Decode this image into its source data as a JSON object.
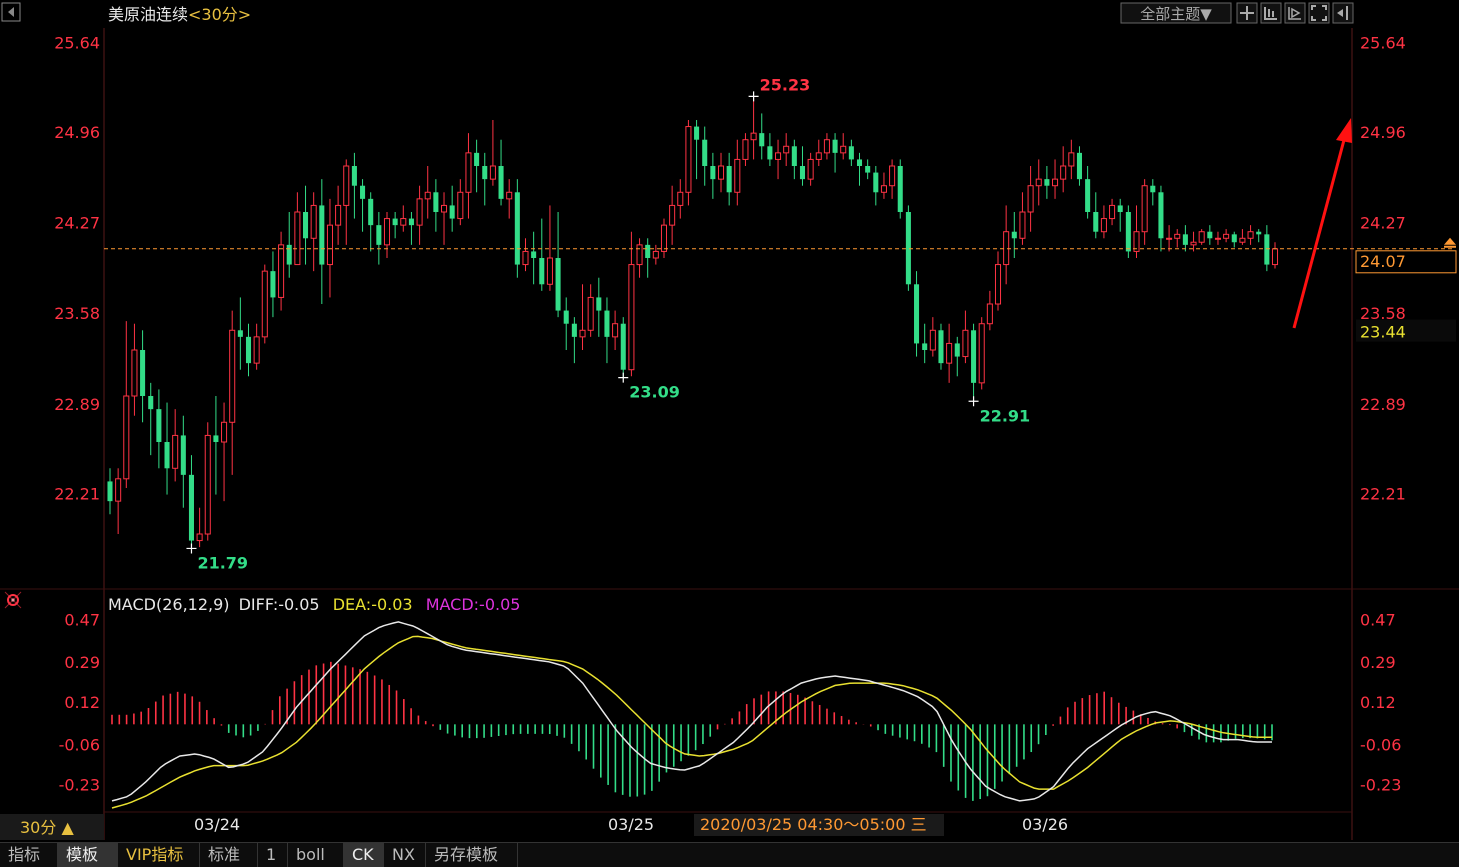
{
  "chart_data": [
    {
      "type": "candlestick",
      "title": "美原油连续",
      "period_label": "<30分>",
      "ylim": [
        21.55,
        25.75
      ],
      "y_ticks": [
        "25.64",
        "24.96",
        "24.27",
        "23.58",
        "22.89",
        "22.21"
      ],
      "last_price": "24.07",
      "side_label": "23.44",
      "annotations": {
        "high": "25.23",
        "low_1": "21.79",
        "low_2": "23.09",
        "low_3": "22.91"
      },
      "candles": [
        [
          22.3,
          22.15,
          22.4,
          22.05
        ],
        [
          22.15,
          22.32,
          22.4,
          21.9
        ],
        [
          22.32,
          22.95,
          23.52,
          22.25
        ],
        [
          22.95,
          23.3,
          23.5,
          22.8
        ],
        [
          23.3,
          22.95,
          23.45,
          22.75
        ],
        [
          22.95,
          22.85,
          23.05,
          22.5
        ],
        [
          22.85,
          22.6,
          23.0,
          22.4
        ],
        [
          22.6,
          22.4,
          22.9,
          22.2
        ],
        [
          22.4,
          22.65,
          22.85,
          22.3
        ],
        [
          22.65,
          22.35,
          22.8,
          22.1
        ],
        [
          22.35,
          21.85,
          22.5,
          21.79
        ],
        [
          21.85,
          21.9,
          22.1,
          21.8
        ],
        [
          21.9,
          22.65,
          22.75,
          21.85
        ],
        [
          22.65,
          22.6,
          22.95,
          22.2
        ],
        [
          22.6,
          22.75,
          22.9,
          22.15
        ],
        [
          22.75,
          23.45,
          23.6,
          22.35
        ],
        [
          23.45,
          23.4,
          23.7,
          23.15
        ],
        [
          23.4,
          23.2,
          23.5,
          23.1
        ],
        [
          23.2,
          23.4,
          23.5,
          23.15
        ],
        [
          23.4,
          23.9,
          23.95,
          23.35
        ],
        [
          23.9,
          23.7,
          24.05,
          23.55
        ],
        [
          23.7,
          24.1,
          24.2,
          23.6
        ],
        [
          24.1,
          23.95,
          24.35,
          23.85
        ],
        [
          23.95,
          24.35,
          24.5,
          24.0
        ],
        [
          24.35,
          24.15,
          24.55,
          23.95
        ],
        [
          24.15,
          24.4,
          24.5,
          23.9
        ],
        [
          24.4,
          23.95,
          24.6,
          23.65
        ],
        [
          23.95,
          24.25,
          24.45,
          23.7
        ],
        [
          24.25,
          24.4,
          24.55,
          24.1
        ],
        [
          24.4,
          24.7,
          24.75,
          24.1
        ],
        [
          24.7,
          24.55,
          24.8,
          24.3
        ],
        [
          24.55,
          24.45,
          24.6,
          24.2
        ],
        [
          24.45,
          24.25,
          24.5,
          24.05
        ],
        [
          24.25,
          24.1,
          24.35,
          23.95
        ],
        [
          24.1,
          24.3,
          24.35,
          24.0
        ],
        [
          24.3,
          24.25,
          24.35,
          24.15
        ],
        [
          24.25,
          24.3,
          24.4,
          24.2
        ],
        [
          24.3,
          24.25,
          24.35,
          24.1
        ],
        [
          24.25,
          24.45,
          24.55,
          24.1
        ],
        [
          24.45,
          24.5,
          24.7,
          24.3
        ],
        [
          24.5,
          24.35,
          24.6,
          24.2
        ],
        [
          24.35,
          24.4,
          24.5,
          24.1
        ],
        [
          24.4,
          24.3,
          24.55,
          24.2
        ],
        [
          24.3,
          24.5,
          24.6,
          24.25
        ],
        [
          24.5,
          24.8,
          24.95,
          24.3
        ],
        [
          24.8,
          24.7,
          24.9,
          24.5
        ],
        [
          24.7,
          24.6,
          24.8,
          24.4
        ],
        [
          24.6,
          24.7,
          25.05,
          24.55
        ],
        [
          24.7,
          24.45,
          24.9,
          24.4
        ],
        [
          24.45,
          24.5,
          24.6,
          24.3
        ],
        [
          24.5,
          23.95,
          24.6,
          23.85
        ],
        [
          23.95,
          24.05,
          24.15,
          23.9
        ],
        [
          24.05,
          24.0,
          24.2,
          23.8
        ],
        [
          24.0,
          23.8,
          24.3,
          23.75
        ],
        [
          23.8,
          24.0,
          24.4,
          23.75
        ],
        [
          24.0,
          23.6,
          24.35,
          23.55
        ],
        [
          23.6,
          23.5,
          23.7,
          23.3
        ],
        [
          23.5,
          23.4,
          23.55,
          23.2
        ],
        [
          23.4,
          23.45,
          23.8,
          23.3
        ],
        [
          23.45,
          23.7,
          23.8,
          23.4
        ],
        [
          23.7,
          23.6,
          23.85,
          23.4
        ],
        [
          23.6,
          23.4,
          23.7,
          23.2
        ],
        [
          23.4,
          23.5,
          23.6,
          23.3
        ],
        [
          23.5,
          23.15,
          23.55,
          23.09
        ],
        [
          23.15,
          23.95,
          24.2,
          23.1
        ],
        [
          23.95,
          24.1,
          24.15,
          23.85
        ],
        [
          24.1,
          24.0,
          24.15,
          23.85
        ],
        [
          24.0,
          24.05,
          24.1,
          23.95
        ],
        [
          24.05,
          24.25,
          24.3,
          24.0
        ],
        [
          24.25,
          24.4,
          24.55,
          24.1
        ],
        [
          24.4,
          24.5,
          24.6,
          24.3
        ],
        [
          24.5,
          25.0,
          25.05,
          24.4
        ],
        [
          25.0,
          24.9,
          25.05,
          24.6
        ],
        [
          24.9,
          24.7,
          25.0,
          24.55
        ],
        [
          24.7,
          24.6,
          24.8,
          24.45
        ],
        [
          24.6,
          24.7,
          24.8,
          24.5
        ],
        [
          24.7,
          24.5,
          24.8,
          24.4
        ],
        [
          24.5,
          24.75,
          24.9,
          24.4
        ],
        [
          24.75,
          24.9,
          24.95,
          24.7
        ],
        [
          24.9,
          24.95,
          25.23,
          24.75
        ],
        [
          24.95,
          24.85,
          25.1,
          24.75
        ],
        [
          24.85,
          24.75,
          24.95,
          24.7
        ],
        [
          24.75,
          24.8,
          24.9,
          24.6
        ],
        [
          24.8,
          24.85,
          24.95,
          24.7
        ],
        [
          24.85,
          24.7,
          24.9,
          24.6
        ],
        [
          24.7,
          24.6,
          24.85,
          24.55
        ],
        [
          24.6,
          24.75,
          24.8,
          24.55
        ],
        [
          24.75,
          24.8,
          24.9,
          24.7
        ],
        [
          24.8,
          24.9,
          24.95,
          24.75
        ],
        [
          24.9,
          24.8,
          24.95,
          24.65
        ],
        [
          24.8,
          24.85,
          24.95,
          24.75
        ],
        [
          24.85,
          24.75,
          24.9,
          24.7
        ],
        [
          24.75,
          24.7,
          24.8,
          24.55
        ],
        [
          24.7,
          24.65,
          24.75,
          24.6
        ],
        [
          24.65,
          24.5,
          24.7,
          24.4
        ],
        [
          24.5,
          24.55,
          24.65,
          24.45
        ],
        [
          24.55,
          24.7,
          24.75,
          24.45
        ],
        [
          24.7,
          24.35,
          24.75,
          24.3
        ],
        [
          24.35,
          23.8,
          24.4,
          23.75
        ],
        [
          23.8,
          23.35,
          23.9,
          23.25
        ],
        [
          23.35,
          23.3,
          23.5,
          23.2
        ],
        [
          23.3,
          23.45,
          23.55,
          23.25
        ],
        [
          23.45,
          23.2,
          23.5,
          23.15
        ],
        [
          23.2,
          23.35,
          23.5,
          23.05
        ],
        [
          23.35,
          23.25,
          23.4,
          23.1
        ],
        [
          23.25,
          23.45,
          23.6,
          23.2
        ],
        [
          23.45,
          23.05,
          23.5,
          22.91
        ],
        [
          23.05,
          23.5,
          23.55,
          23.0
        ],
        [
          23.5,
          23.65,
          23.75,
          23.45
        ],
        [
          23.65,
          23.95,
          24.05,
          23.6
        ],
        [
          23.95,
          24.2,
          24.4,
          23.8
        ],
        [
          24.2,
          24.15,
          24.35,
          24.0
        ],
        [
          24.15,
          24.35,
          24.5,
          24.1
        ],
        [
          24.35,
          24.55,
          24.7,
          24.2
        ],
        [
          24.55,
          24.6,
          24.75,
          24.4
        ],
        [
          24.6,
          24.55,
          24.7,
          24.45
        ],
        [
          24.55,
          24.6,
          24.75,
          24.45
        ],
        [
          24.6,
          24.7,
          24.85,
          24.5
        ],
        [
          24.7,
          24.8,
          24.9,
          24.6
        ],
        [
          24.8,
          24.6,
          24.85,
          24.55
        ],
        [
          24.6,
          24.35,
          24.7,
          24.3
        ],
        [
          24.35,
          24.2,
          24.5,
          24.15
        ],
        [
          24.2,
          24.3,
          24.4,
          24.15
        ],
        [
          24.3,
          24.4,
          24.45,
          24.25
        ],
        [
          24.4,
          24.35,
          24.45,
          24.2
        ],
        [
          24.35,
          24.05,
          24.4,
          24.0
        ],
        [
          24.05,
          24.2,
          24.4,
          24.0
        ],
        [
          24.2,
          24.55,
          24.6,
          24.1
        ],
        [
          24.55,
          24.5,
          24.6,
          24.4
        ],
        [
          24.5,
          24.15,
          24.55,
          24.05
        ],
        [
          24.15,
          24.15,
          24.25,
          24.05
        ],
        [
          24.15,
          24.18,
          24.22,
          24.08
        ],
        [
          24.18,
          24.1,
          24.25,
          24.05
        ],
        [
          24.1,
          24.12,
          24.2,
          24.05
        ],
        [
          24.12,
          24.2,
          24.22,
          24.1
        ],
        [
          24.2,
          24.15,
          24.25,
          24.1
        ],
        [
          24.15,
          24.15,
          24.2,
          24.1
        ],
        [
          24.15,
          24.18,
          24.22,
          24.12
        ],
        [
          24.18,
          24.12,
          24.2,
          24.08
        ],
        [
          24.12,
          24.15,
          24.22,
          24.1
        ],
        [
          24.15,
          24.2,
          24.25,
          24.1
        ],
        [
          24.2,
          24.18,
          24.22,
          24.12
        ],
        [
          24.18,
          23.95,
          24.25,
          23.9
        ],
        [
          23.95,
          24.07,
          24.12,
          23.92
        ]
      ]
    },
    {
      "type": "bar+line",
      "title": "MACD(26,12,9)",
      "legend": {
        "diff": "DIFF:-0.05",
        "dea": "DEA:-0.03",
        "macd": "MACD:-0.05"
      },
      "ylim": [
        -0.33,
        0.51
      ],
      "y_ticks": [
        "0.47",
        "0.29",
        "0.12",
        "-0.06",
        "-0.23"
      ],
      "diff": [
        -0.3,
        -0.28,
        -0.22,
        -0.15,
        -0.11,
        -0.1,
        -0.12,
        -0.16,
        -0.14,
        -0.09,
        0.0,
        0.1,
        0.18,
        0.26,
        0.33,
        0.4,
        0.44,
        0.46,
        0.44,
        0.4,
        0.36,
        0.34,
        0.33,
        0.32,
        0.31,
        0.3,
        0.29,
        0.27,
        0.2,
        0.1,
        0.0,
        -0.08,
        -0.14,
        -0.16,
        -0.17,
        -0.15,
        -0.1,
        -0.05,
        0.02,
        0.1,
        0.16,
        0.2,
        0.22,
        0.23,
        0.22,
        0.21,
        0.19,
        0.17,
        0.14,
        0.09,
        -0.05,
        -0.16,
        -0.24,
        -0.28,
        -0.3,
        -0.29,
        -0.24,
        -0.15,
        -0.08,
        -0.03,
        0.02,
        0.06,
        0.08,
        0.06,
        0.02,
        -0.02,
        -0.04,
        -0.04,
        -0.05,
        -0.05
      ],
      "dea": [
        -0.33,
        -0.31,
        -0.28,
        -0.24,
        -0.2,
        -0.17,
        -0.15,
        -0.15,
        -0.15,
        -0.13,
        -0.1,
        -0.05,
        0.02,
        0.1,
        0.18,
        0.26,
        0.32,
        0.37,
        0.4,
        0.39,
        0.37,
        0.35,
        0.34,
        0.33,
        0.32,
        0.31,
        0.3,
        0.29,
        0.26,
        0.21,
        0.15,
        0.08,
        0.01,
        -0.06,
        -0.1,
        -0.11,
        -0.1,
        -0.08,
        -0.05,
        0.01,
        0.07,
        0.12,
        0.16,
        0.19,
        0.2,
        0.2,
        0.2,
        0.19,
        0.17,
        0.14,
        0.08,
        0.01,
        -0.08,
        -0.16,
        -0.22,
        -0.25,
        -0.25,
        -0.21,
        -0.16,
        -0.1,
        -0.04,
        0.0,
        0.03,
        0.04,
        0.03,
        0.01,
        -0.01,
        -0.02,
        -0.03,
        -0.03
      ],
      "macd": [
        0.07,
        0.07,
        0.09,
        0.16,
        0.18,
        0.15,
        0.06,
        -0.02,
        -0.04,
        0.01,
        0.16,
        0.24,
        0.3,
        0.32,
        0.3,
        0.28,
        0.24,
        0.18,
        0.08,
        0.02,
        -0.02,
        -0.04,
        -0.04,
        -0.03,
        -0.02,
        -0.02,
        -0.02,
        -0.04,
        -0.12,
        -0.22,
        -0.3,
        -0.32,
        -0.3,
        -0.2,
        -0.14,
        -0.08,
        0.0,
        0.06,
        0.14,
        0.18,
        0.18,
        0.16,
        0.12,
        0.08,
        0.04,
        0.02,
        -0.02,
        -0.04,
        -0.06,
        -0.1,
        -0.26,
        -0.34,
        -0.32,
        -0.24,
        -0.16,
        -0.08,
        0.02,
        0.12,
        0.16,
        0.18,
        0.12,
        0.08,
        0.04,
        0.02,
        -0.02,
        -0.06,
        -0.06,
        -0.04,
        -0.04,
        -0.05
      ]
    }
  ],
  "header": {
    "theme_button": "全部主题▼"
  },
  "x_axis": {
    "dates": [
      "03/24",
      "03/25",
      "03/26"
    ],
    "hover_time": "2020/03/25 04:30～05:00 三"
  },
  "period_selector": "30分 ▲",
  "bottom_tabs": [
    {
      "label": "指标",
      "active": false
    },
    {
      "label": "模板",
      "active": true
    },
    {
      "label": "VIP指标",
      "active": false,
      "vip": true
    },
    {
      "label": "标准",
      "active": false
    },
    {
      "label": "1",
      "active": false
    },
    {
      "label": "boll",
      "active": false
    },
    {
      "label": "CK",
      "active": true
    },
    {
      "label": "NX",
      "active": false
    },
    {
      "label": "另存模板",
      "active": false
    }
  ],
  "colors": {
    "up": "#ff3344",
    "down": "#33dd88",
    "axis_text": "#ff3344",
    "diff_line": "#e8e8e8",
    "dea_line": "#e8e030",
    "macd_label": "#dd33dd",
    "last_price": "#ff9933",
    "annotation_arrow": "#ff1111"
  }
}
